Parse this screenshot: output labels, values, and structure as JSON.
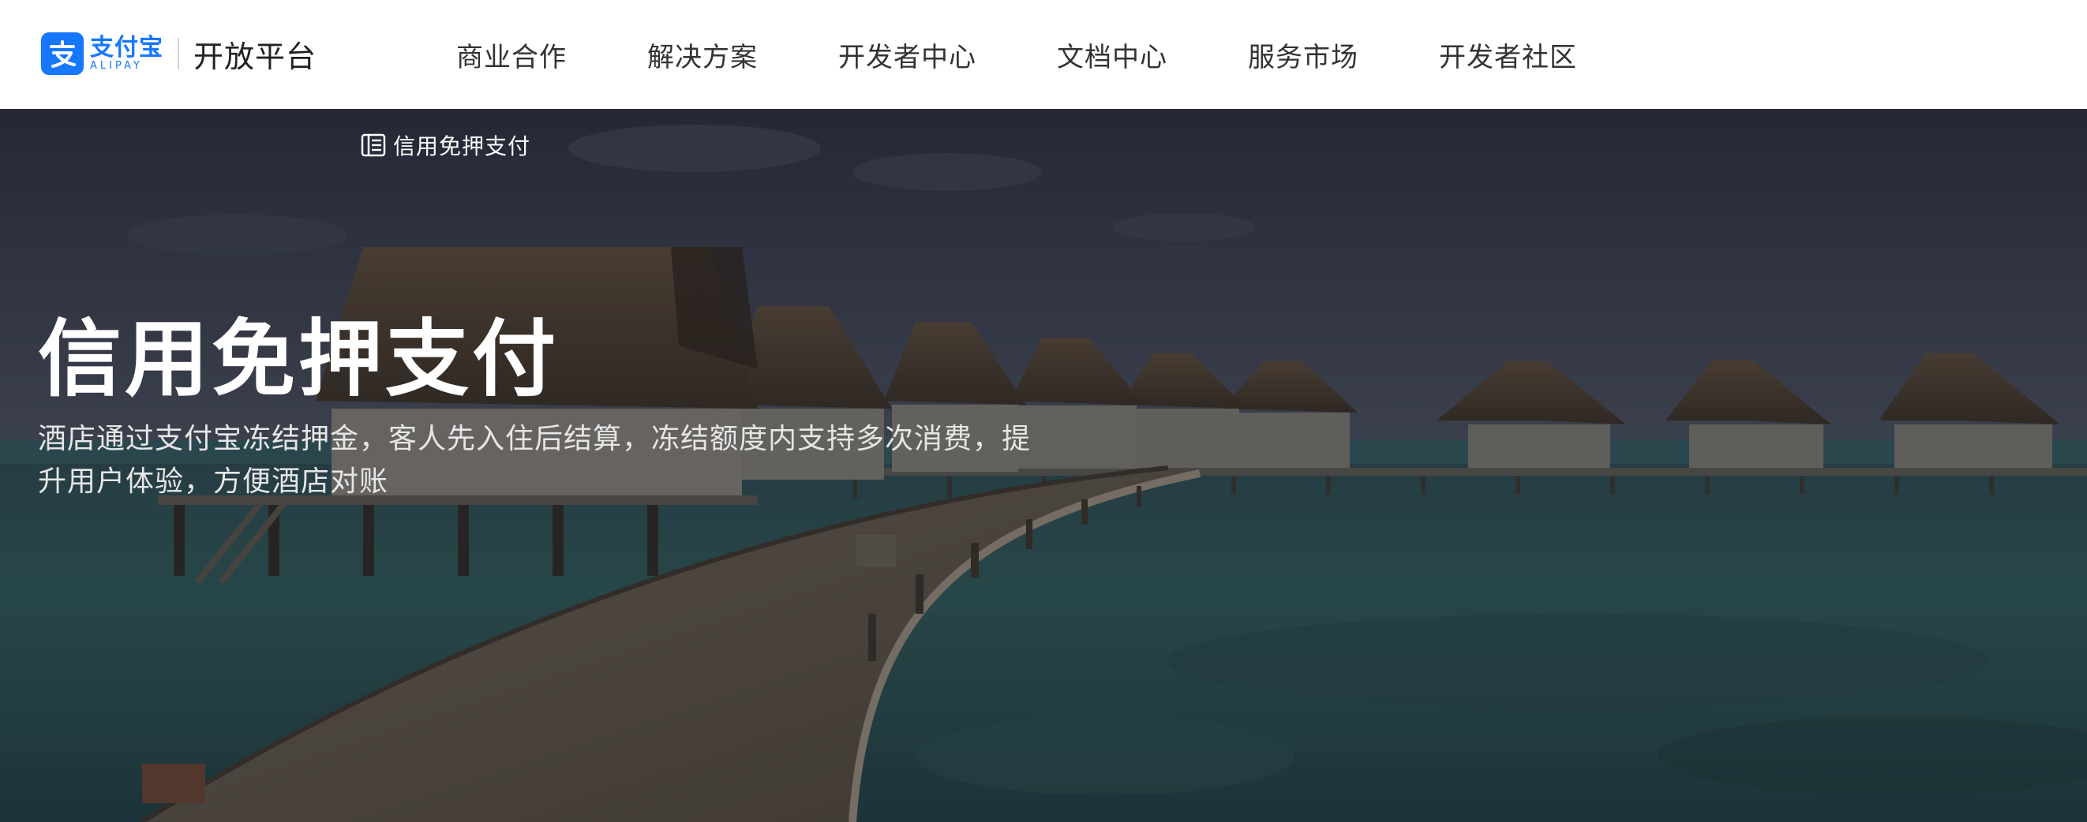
{
  "header": {
    "logo": {
      "cn": "支付宝",
      "en": "ALIPAY",
      "brand_color": "#1677ff",
      "icon": "alipay-logo-icon"
    },
    "platform_title": "开放平台",
    "nav": [
      {
        "label": "商业合作"
      },
      {
        "label": "解决方案"
      },
      {
        "label": "开发者中心"
      },
      {
        "label": "文档中心"
      },
      {
        "label": "服务市场"
      },
      {
        "label": "开发者社区"
      }
    ]
  },
  "hero": {
    "breadcrumb": {
      "icon": "document-list-icon",
      "label": "信用免押支付"
    },
    "title": "信用免押支付",
    "description": "酒店通过支付宝冻结押金，客人先入住后结算，冻结额度内支持多次消费，提升用户体验，方便酒店对账",
    "background": "overwater-bungalows-photo"
  }
}
